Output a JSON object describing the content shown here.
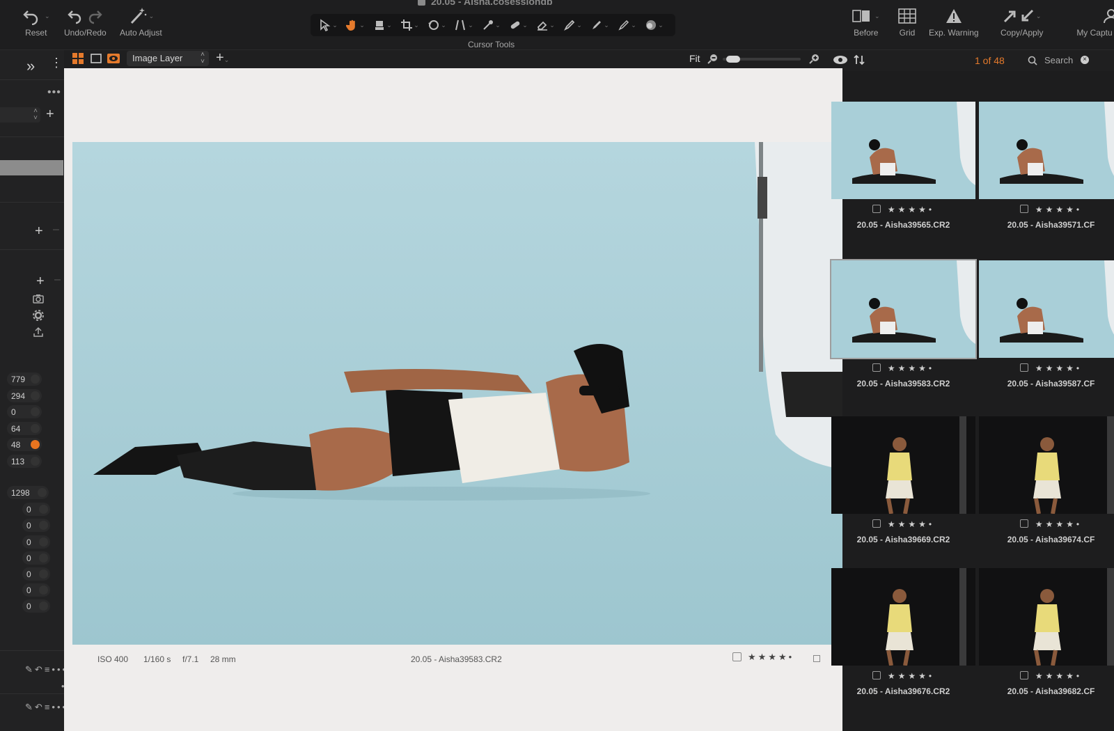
{
  "window": {
    "title": "20.05 - Aisha.cosessiondb"
  },
  "toolbar": {
    "reset_label": "Reset",
    "undo_redo_label": "Undo/Redo",
    "auto_adjust_label": "Auto Adjust",
    "cursor_tools_label": "Cursor Tools",
    "cursor_tools": [
      "select-icon",
      "hand-icon",
      "loupe-icon",
      "crop-icon",
      "rotate-icon",
      "keystone-icon",
      "spot-icon",
      "heal-icon",
      "eraser-icon",
      "brush-icon",
      "gradient-icon",
      "fill-icon",
      "color-picker-icon"
    ],
    "before_label": "Before",
    "grid_label": "Grid",
    "exp_warning_label": "Exp. Warning",
    "copy_apply_label": "Copy/Apply",
    "my_capture_label": "My Captu"
  },
  "viewer": {
    "layer_select": "Image Layer",
    "fit_label": "Fit",
    "zoom_level": 0.05,
    "meta": {
      "iso": "ISO 400",
      "shutter": "1/160 s",
      "aperture": "f/7.1",
      "focal": "28 mm",
      "filename": "20.05 - Aisha39583.CR2"
    },
    "stars": "★★★★•"
  },
  "left_panel": {
    "values_a": [
      "779",
      "294",
      "0",
      "64",
      "48",
      "113"
    ],
    "values_b": [
      "1298",
      "0",
      "0",
      "0",
      "0",
      "0",
      "0",
      "0"
    ],
    "accent": "#e8741f"
  },
  "browser": {
    "counter": "1 of 48",
    "search_placeholder": "Search",
    "stars": "★★★★•",
    "thumbs": [
      {
        "filename": "20.05 - Aisha39565.CR2",
        "theme": "blue"
      },
      {
        "filename": "20.05 - Aisha39571.CF",
        "theme": "blue"
      },
      {
        "filename": "20.05 - Aisha39583.CR2",
        "theme": "blue",
        "selected": true
      },
      {
        "filename": "20.05 - Aisha39587.CF",
        "theme": "blue"
      },
      {
        "filename": "20.05 - Aisha39669.CR2",
        "theme": "dark"
      },
      {
        "filename": "20.05 - Aisha39674.CF",
        "theme": "dark"
      },
      {
        "filename": "20.05 - Aisha39676.CR2",
        "theme": "dark"
      },
      {
        "filename": "20.05 - Aisha39682.CF",
        "theme": "dark"
      }
    ]
  }
}
